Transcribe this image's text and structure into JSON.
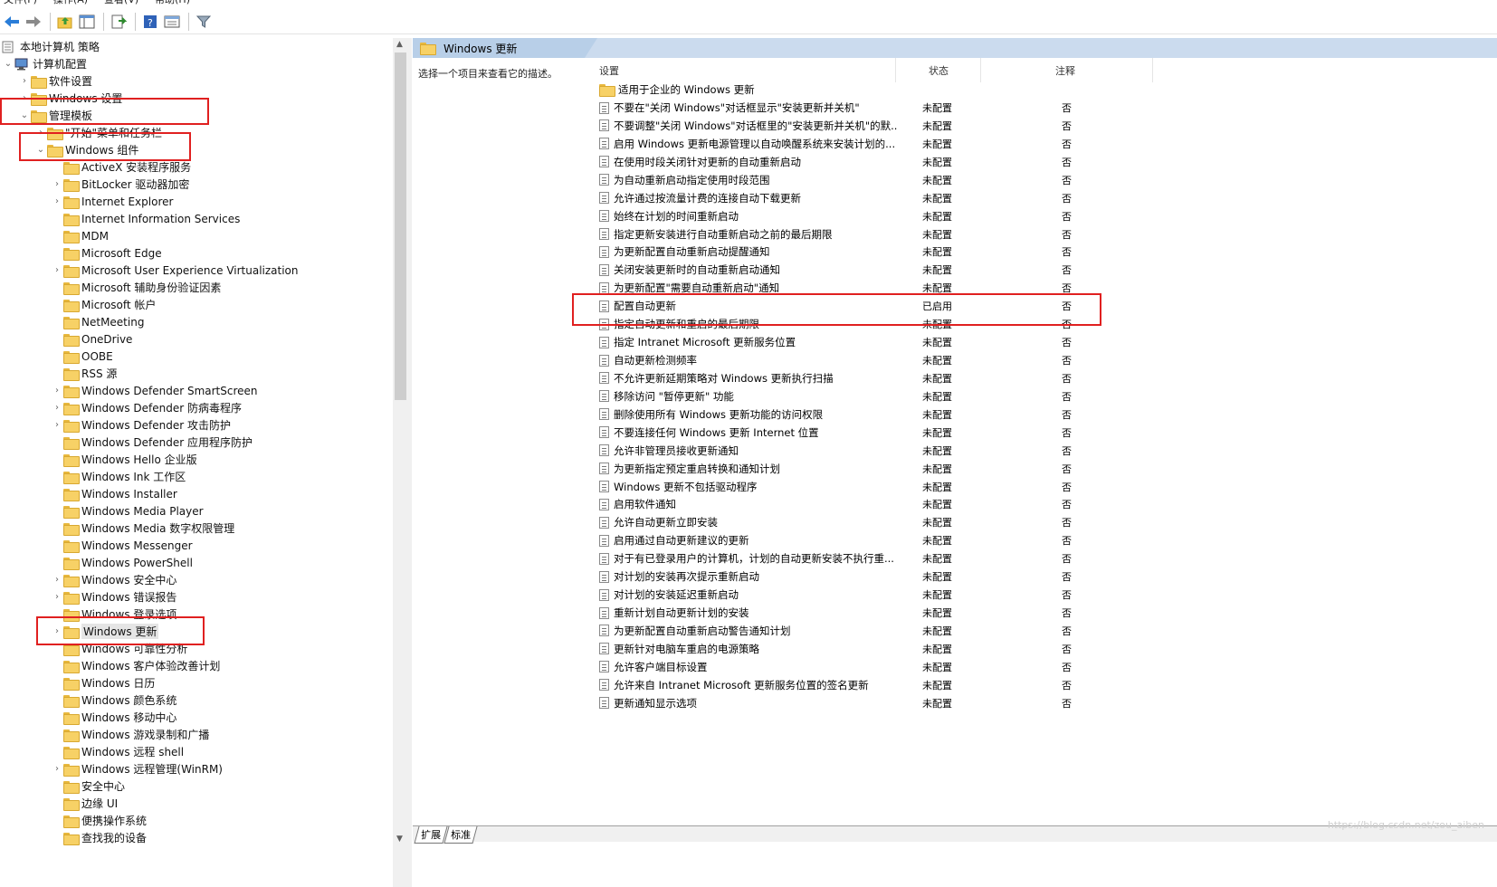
{
  "menubar": [
    "文件(F)",
    "操作(A)",
    "查看(V)",
    "帮助(H)"
  ],
  "toolbar": {
    "icons": [
      "back-icon",
      "forward-icon",
      "up-folder-icon",
      "show-hide-tree-icon",
      "export-list-icon",
      "help-icon",
      "properties-icon",
      "filter-icon"
    ]
  },
  "tree": {
    "root": "本地计算机 策略",
    "computer_config": "计算机配置",
    "software_settings": "软件设置",
    "windows_settings": "Windows 设置",
    "admin_templates": "管理模板",
    "start_menu": "\"开始\"菜单和任务栏",
    "windows_components": "Windows 组件",
    "components": [
      {
        "label": "ActiveX 安装程序服务",
        "expandable": false
      },
      {
        "label": "BitLocker 驱动器加密",
        "expandable": true
      },
      {
        "label": "Internet Explorer",
        "expandable": true
      },
      {
        "label": "Internet Information Services",
        "expandable": false
      },
      {
        "label": "MDM",
        "expandable": false
      },
      {
        "label": "Microsoft Edge",
        "expandable": false
      },
      {
        "label": "Microsoft User Experience Virtualization",
        "expandable": true
      },
      {
        "label": "Microsoft 辅助身份验证因素",
        "expandable": false
      },
      {
        "label": "Microsoft 帐户",
        "expandable": false
      },
      {
        "label": "NetMeeting",
        "expandable": false
      },
      {
        "label": "OneDrive",
        "expandable": false
      },
      {
        "label": "OOBE",
        "expandable": false
      },
      {
        "label": "RSS 源",
        "expandable": false
      },
      {
        "label": "Windows Defender SmartScreen",
        "expandable": true
      },
      {
        "label": "Windows Defender 防病毒程序",
        "expandable": true
      },
      {
        "label": "Windows Defender 攻击防护",
        "expandable": true
      },
      {
        "label": "Windows Defender 应用程序防护",
        "expandable": false
      },
      {
        "label": "Windows Hello 企业版",
        "expandable": false
      },
      {
        "label": "Windows Ink 工作区",
        "expandable": false
      },
      {
        "label": "Windows Installer",
        "expandable": false
      },
      {
        "label": "Windows Media Player",
        "expandable": false
      },
      {
        "label": "Windows Media 数字权限管理",
        "expandable": false
      },
      {
        "label": "Windows Messenger",
        "expandable": false
      },
      {
        "label": "Windows PowerShell",
        "expandable": false
      },
      {
        "label": "Windows 安全中心",
        "expandable": true
      },
      {
        "label": "Windows 错误报告",
        "expandable": true
      },
      {
        "label": "Windows 登录选项",
        "expandable": false
      },
      {
        "label": "Windows 更新",
        "expandable": true,
        "selected": true
      },
      {
        "label": "Windows 可靠性分析",
        "expandable": false
      },
      {
        "label": "Windows 客户体验改善计划",
        "expandable": false
      },
      {
        "label": "Windows 日历",
        "expandable": false
      },
      {
        "label": "Windows 颜色系统",
        "expandable": false
      },
      {
        "label": "Windows 移动中心",
        "expandable": false
      },
      {
        "label": "Windows 游戏录制和广播",
        "expandable": false
      },
      {
        "label": "Windows 远程 shell",
        "expandable": false
      },
      {
        "label": "Windows 远程管理(WinRM)",
        "expandable": true
      },
      {
        "label": "安全中心",
        "expandable": false
      },
      {
        "label": "边缘 UI",
        "expandable": false
      },
      {
        "label": "便携操作系统",
        "expandable": false
      },
      {
        "label": "查找我的设备",
        "expandable": false
      }
    ]
  },
  "right": {
    "header_title": "Windows 更新",
    "description": "选择一个项目来查看它的描述。",
    "columns": {
      "setting": "设置",
      "state": "状态",
      "note": "注释"
    },
    "folder_row": "适用于企业的 Windows 更新",
    "rows": [
      {
        "name": "不要在\"关闭 Windows\"对话框显示\"安装更新并关机\"",
        "state": "未配置",
        "note": "否"
      },
      {
        "name": "不要调整\"关闭 Windows\"对话框里的\"安装更新并关机\"的默...",
        "state": "未配置",
        "note": "否"
      },
      {
        "name": "启用 Windows 更新电源管理以自动唤醒系统来安装计划的...",
        "state": "未配置",
        "note": "否"
      },
      {
        "name": "在使用时段关闭针对更新的自动重新启动",
        "state": "未配置",
        "note": "否"
      },
      {
        "name": "为自动重新启动指定使用时段范围",
        "state": "未配置",
        "note": "否"
      },
      {
        "name": "允许通过按流量计费的连接自动下载更新",
        "state": "未配置",
        "note": "否"
      },
      {
        "name": "始终在计划的时间重新启动",
        "state": "未配置",
        "note": "否"
      },
      {
        "name": "指定更新安装进行自动重新启动之前的最后期限",
        "state": "未配置",
        "note": "否"
      },
      {
        "name": "为更新配置自动重新启动提醒通知",
        "state": "未配置",
        "note": "否"
      },
      {
        "name": "关闭安装更新时的自动重新启动通知",
        "state": "未配置",
        "note": "否"
      },
      {
        "name": "为更新配置\"需要自动重新启动\"通知",
        "state": "未配置",
        "note": "否"
      },
      {
        "name": "配置自动更新",
        "state": "已启用",
        "note": "否"
      },
      {
        "name": "指定自动更新和重启的最后期限",
        "state": "未配置",
        "note": "否"
      },
      {
        "name": "指定 Intranet Microsoft 更新服务位置",
        "state": "未配置",
        "note": "否"
      },
      {
        "name": "自动更新检测频率",
        "state": "未配置",
        "note": "否"
      },
      {
        "name": "不允许更新延期策略对 Windows 更新执行扫描",
        "state": "未配置",
        "note": "否"
      },
      {
        "name": "移除访问 \"暂停更新\" 功能",
        "state": "未配置",
        "note": "否"
      },
      {
        "name": "删除使用所有 Windows 更新功能的访问权限",
        "state": "未配置",
        "note": "否"
      },
      {
        "name": "不要连接任何 Windows 更新 Internet 位置",
        "state": "未配置",
        "note": "否"
      },
      {
        "name": "允许非管理员接收更新通知",
        "state": "未配置",
        "note": "否"
      },
      {
        "name": "为更新指定预定重启转换和通知计划",
        "state": "未配置",
        "note": "否"
      },
      {
        "name": "Windows 更新不包括驱动程序",
        "state": "未配置",
        "note": "否"
      },
      {
        "name": "启用软件通知",
        "state": "未配置",
        "note": "否"
      },
      {
        "name": "允许自动更新立即安装",
        "state": "未配置",
        "note": "否"
      },
      {
        "name": "启用通过自动更新建议的更新",
        "state": "未配置",
        "note": "否"
      },
      {
        "name": "对于有已登录用户的计算机，计划的自动更新安装不执行重...",
        "state": "未配置",
        "note": "否"
      },
      {
        "name": "对计划的安装再次提示重新启动",
        "state": "未配置",
        "note": "否"
      },
      {
        "name": "对计划的安装延迟重新启动",
        "state": "未配置",
        "note": "否"
      },
      {
        "name": "重新计划自动更新计划的安装",
        "state": "未配置",
        "note": "否"
      },
      {
        "name": "为更新配置自动重新启动警告通知计划",
        "state": "未配置",
        "note": "否"
      },
      {
        "name": "更新针对电脑车重启的电源策略",
        "state": "未配置",
        "note": "否"
      },
      {
        "name": "允许客户端目标设置",
        "state": "未配置",
        "note": "否"
      },
      {
        "name": "允许来自 Intranet Microsoft 更新服务位置的签名更新",
        "state": "未配置",
        "note": "否"
      },
      {
        "name": "更新通知显示选项",
        "state": "未配置",
        "note": "否"
      }
    ]
  },
  "bottom_tabs": [
    "扩展",
    "标准"
  ],
  "watermark": "https://blog.csdn.net/zou_aiben",
  "colors": {
    "highlight_box": "#e02020",
    "header_bg": "#cbdbee",
    "folder": "#f7d166"
  }
}
